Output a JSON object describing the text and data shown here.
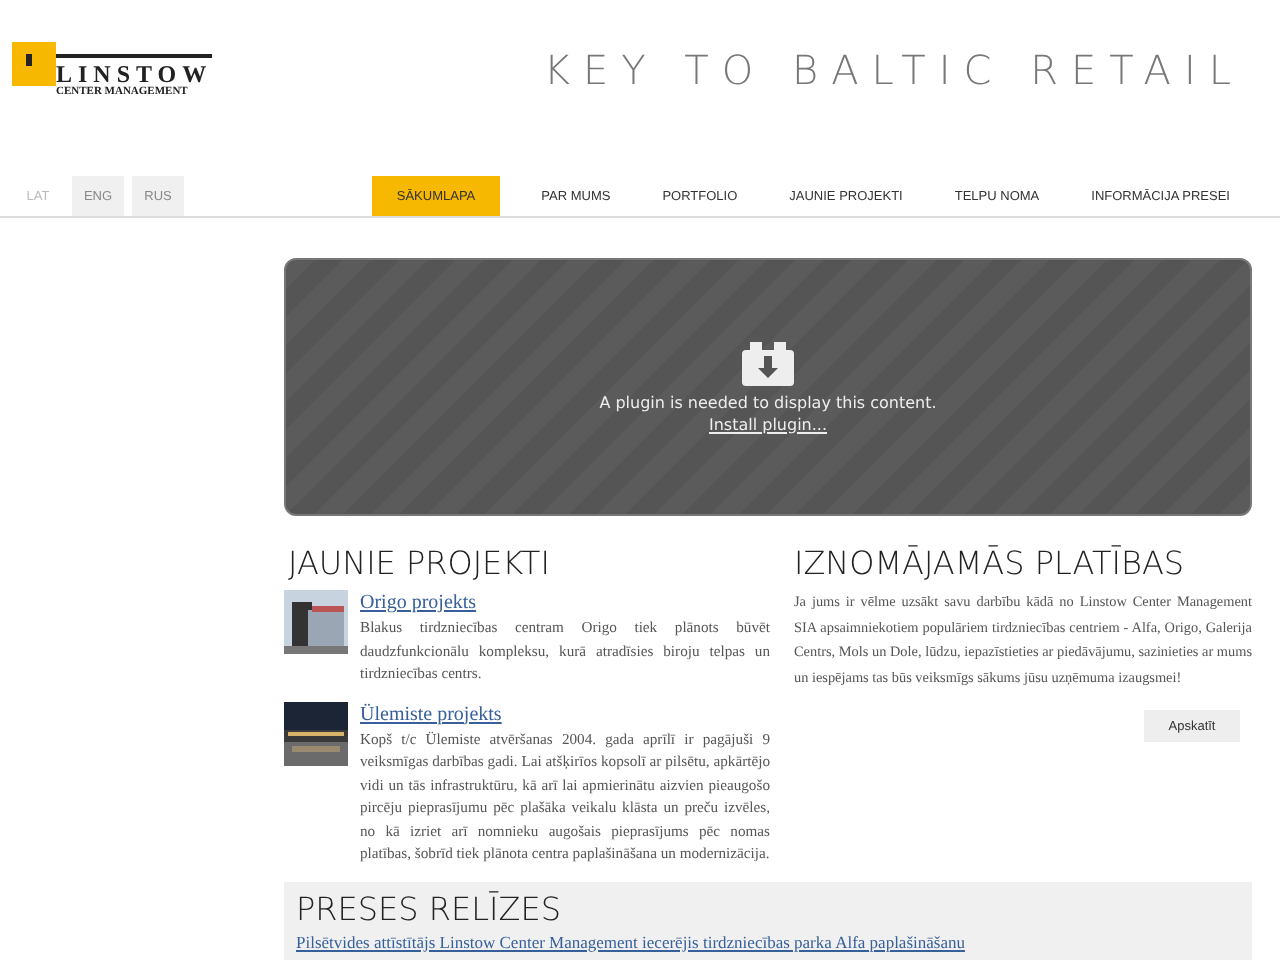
{
  "logo": {
    "name": "LINSTOW",
    "subtitle": "CENTER MANAGEMENT"
  },
  "tagline": "KEY TO BALTIC RETAIL",
  "languages": [
    {
      "label": "LAT",
      "selected": true
    },
    {
      "label": "ENG",
      "selected": false
    },
    {
      "label": "RUS",
      "selected": false
    }
  ],
  "nav": [
    {
      "label": "SĀKUMLAPA",
      "selected": true
    },
    {
      "label": "PAR MUMS",
      "selected": false
    },
    {
      "label": "PORTFOLIO",
      "selected": false
    },
    {
      "label": "JAUNIE PROJEKTI",
      "selected": false
    },
    {
      "label": "TELPU NOMA",
      "selected": false
    },
    {
      "label": "INFORMĀCIJA PRESEI",
      "selected": false
    }
  ],
  "plugin": {
    "message": "A plugin is needed to display this content.",
    "link": "Install plugin..."
  },
  "new_projects": {
    "title": "JAUNIE PROJEKTI",
    "items": [
      {
        "title": "Origo projekts",
        "text": "Blakus tirdzniecības centram Origo tiek plānots būvēt daudzfunkcionālu kompleksu, kurā atradīsies biroju telpas un tirdzniecības centrs.",
        "kind": "picture"
      },
      {
        "title": "Ülemiste projekts",
        "text": "Kopš t/c Ülemiste atvēršanas 2004. gada aprīlī ir pagājuši 9 veiksmīgas darbības gadi. Lai atšķirīos kopsolī ar pilsētu, apkārtējo vidi un tās infrastruktūru, kā arī lai apmierinātu aizvien pieaugošo pircēju pieprasījumu pēc plašāka veikalu klāsta un preču izvēles, no kā izriet arī nomnieku augošais pieprasījums pēc nomas platības, šobrīd tiek plānota centra paplašināšana un modernizācija.",
        "kind": "picture"
      }
    ]
  },
  "rental": {
    "title": "IZNOMĀJAMĀS PLATĪBAS",
    "text": "Ja jums ir vēlme uzsākt savu darbību kādā no Linstow Center Management SIA apsaimniekotiem populāriem tirdzniecības centriem - Alfa, Origo, Galerija Centrs, Mols un Dole, lūdzu, iepazīstieties ar piedāvājumu, sazinieties ar mums un iespējams tas būs veiksmīgs sākums jūsu uzņēmuma izaugsmei!",
    "button": "Apskatīt"
  },
  "press": {
    "title": "PRESES RELĪZES",
    "link": "Pilsētvides attīstītājs Linstow Center Management iecerējis tirdzniecības parka Alfa paplašināšanu"
  }
}
